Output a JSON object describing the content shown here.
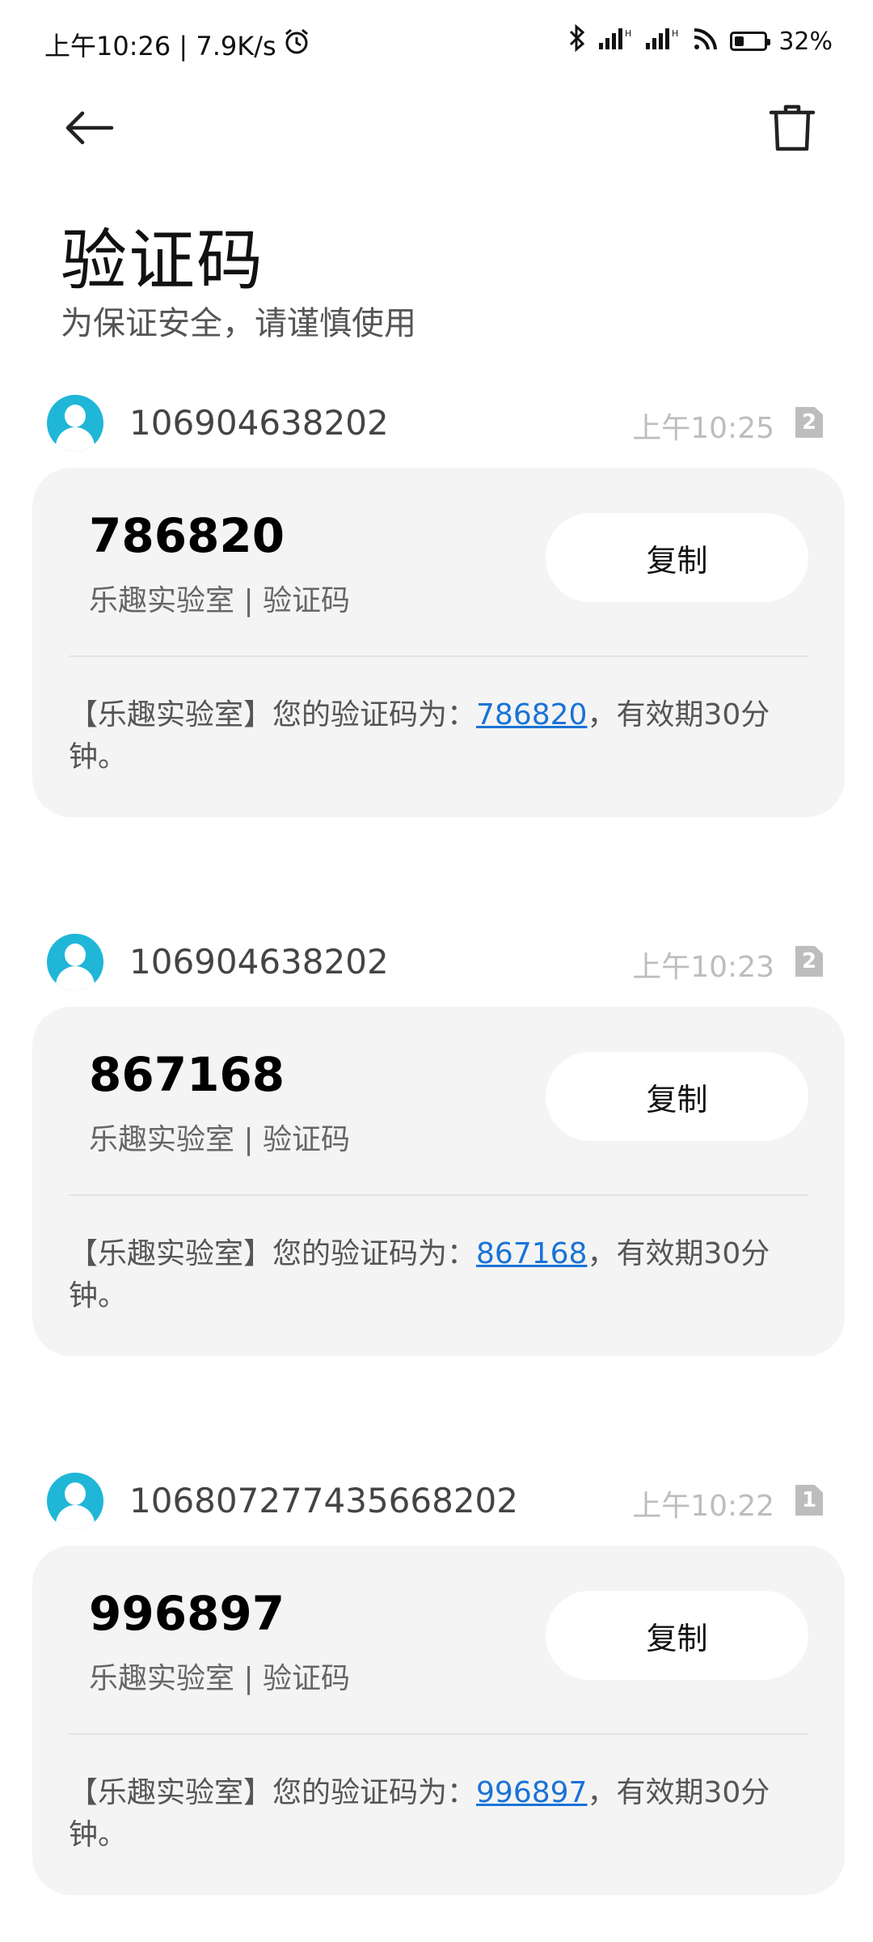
{
  "status_bar": {
    "time_speed": "上午10:26 | 7.9K/s",
    "battery": "32%",
    "battery_level": 0.32
  },
  "header": {
    "title": "验证码",
    "subtitle": "为保证安全，请谨慎使用"
  },
  "messages": [
    {
      "sender": "106904638202",
      "time": "上午10:25",
      "sim": "2",
      "code": "786820",
      "source": "乐趣实验室 | 验证码",
      "copy_label": "复制",
      "text_prefix": "【乐趣实验室】您的验证码为：",
      "text_code": "786820",
      "text_suffix": "，有效期30分钟。"
    },
    {
      "sender": "106904638202",
      "time": "上午10:23",
      "sim": "2",
      "code": "867168",
      "source": "乐趣实验室 | 验证码",
      "copy_label": "复制",
      "text_prefix": "【乐趣实验室】您的验证码为：",
      "text_code": "867168",
      "text_suffix": "，有效期30分钟。"
    },
    {
      "sender": "10680727743566820 2",
      "time": "上午10:22",
      "sim": "1",
      "code": "996897",
      "source": "乐趣实验室 | 验证码",
      "copy_label": "复制",
      "text_prefix": "【乐趣实验室】您的验证码为：",
      "text_code": "996897",
      "text_suffix": "，有效期30分钟。"
    }
  ]
}
